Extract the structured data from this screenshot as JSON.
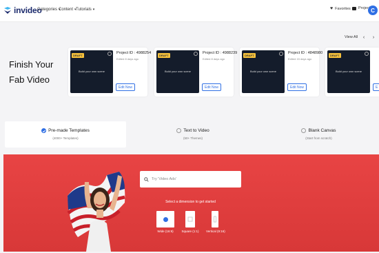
{
  "brand": {
    "name": "invideo",
    "accent": "#2f6fe4",
    "logo_color": "#1c2b6d"
  },
  "nav": {
    "items": [
      {
        "label": "Categories"
      },
      {
        "label": "Content"
      },
      {
        "label": "Tutorials"
      }
    ],
    "favorites": "Favorites",
    "projects": "Projects",
    "avatar_initial": "C"
  },
  "finish": {
    "title_line1": "Finish Your",
    "title_line2": "Fab Video",
    "view_all": "View All",
    "prev_icon": "chevron-left-icon",
    "next_icon": "chevron-right-icon",
    "cards": [
      {
        "badge": "DRAFT",
        "thumb_text": "Build your own scene",
        "project_id": "Project ID : 4988254",
        "edited": "Edited 8 days ago",
        "edit_label": "Edit Now"
      },
      {
        "badge": "DRAFT",
        "thumb_text": "Build your own scene",
        "project_id": "Project ID : 4988239",
        "edited": "Edited 8 days ago",
        "edit_label": "Edit Now"
      },
      {
        "badge": "DRAFT",
        "thumb_text": "Build your own scene",
        "project_id": "Project ID : 4848980",
        "edited": "Edited 15 days ago",
        "edit_label": "Edit Now"
      },
      {
        "badge": "DRAFT",
        "thumb_text": "Build your own scene",
        "project_id": "",
        "edited": "",
        "edit_label": "E"
      }
    ]
  },
  "tabs": [
    {
      "label": "Pre-made Templates",
      "sub": "(4000+ Templates)",
      "selected": true
    },
    {
      "label": "Text to Video",
      "sub": "(50+ Themes)",
      "selected": false
    },
    {
      "label": "Blank Canvas",
      "sub": "(Start from scratch)",
      "selected": false
    }
  ],
  "hero": {
    "bg_color": "#e03e3e",
    "search_placeholder": "Try 'Video Ads'",
    "dimension_title": "Select a dimension to get started",
    "dimensions": [
      {
        "label": "Wide (16:9)",
        "selected": true
      },
      {
        "label": "Square (1:1)",
        "selected": false
      },
      {
        "label": "Vertical (9:16)",
        "selected": false
      }
    ]
  }
}
